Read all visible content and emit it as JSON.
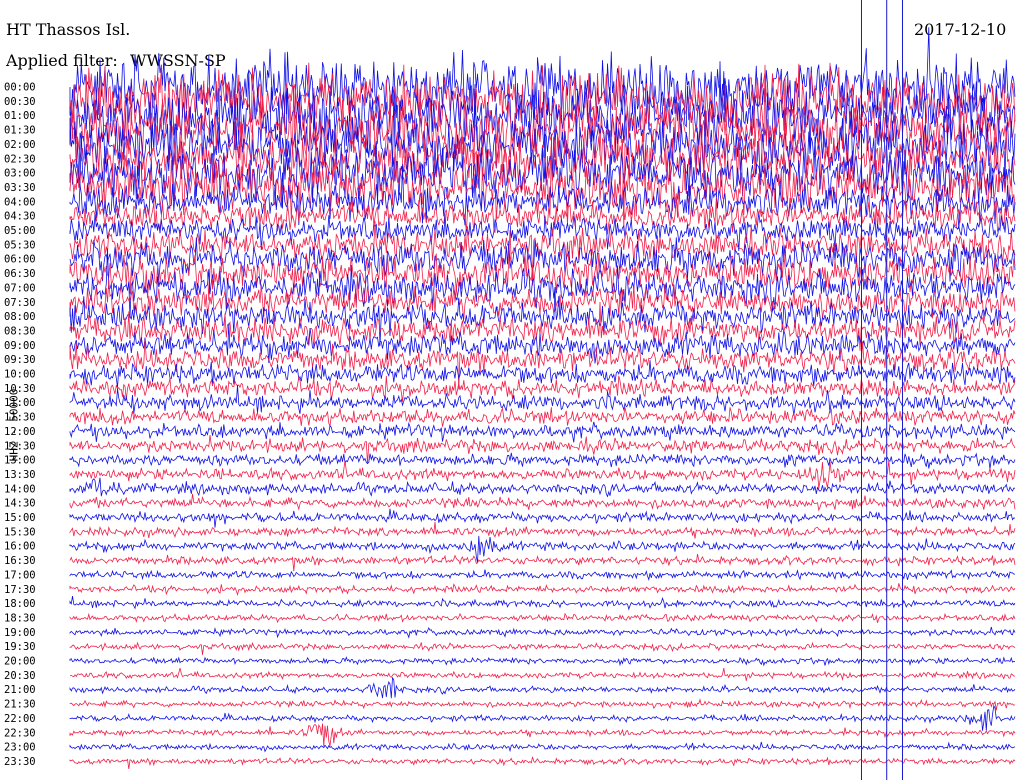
{
  "header": {
    "station": "HT Thassos Isl.",
    "date": "2017-12-10",
    "filter_label": "Applied filter:",
    "filter_value": "WWSSN-SP"
  },
  "colors": {
    "trace_a": "#1010e6",
    "trace_b": "#f0204a",
    "vline": "#1a1ad0"
  },
  "chart_data": {
    "type": "line",
    "title": "HT Thassos Isl.",
    "ylabel": "HHZ - 50000",
    "tick_labels": [
      "00:00",
      "00:30",
      "01:00",
      "01:30",
      "02:00",
      "02:30",
      "03:00",
      "03:30",
      "04:00",
      "04:30",
      "05:00",
      "05:30",
      "06:00",
      "06:30",
      "07:00",
      "07:30",
      "08:00",
      "08:30",
      "09:00",
      "09:30",
      "10:00",
      "10:30",
      "11:00",
      "11:30",
      "12:00",
      "12:30",
      "13:00",
      "13:30",
      "14:00",
      "14:30",
      "15:00",
      "15:30",
      "16:00",
      "16:30",
      "17:00",
      "17:30",
      "18:00",
      "18:30",
      "19:00",
      "19:30",
      "20:00",
      "20:30",
      "21:00",
      "21:30",
      "22:00",
      "22:30",
      "23:00",
      "23:30"
    ],
    "series": [
      {
        "values": [
          1.0,
          1.0,
          0.95,
          0.95,
          0.9,
          0.9,
          0.85,
          0.8,
          0.55,
          0.45,
          0.4,
          0.45,
          0.55,
          0.55,
          0.5,
          0.45,
          0.42,
          0.4,
          0.38,
          0.35,
          0.3,
          0.26,
          0.24,
          0.22,
          0.2,
          0.18,
          0.16,
          0.15,
          0.14,
          0.13,
          0.12,
          0.11,
          0.11,
          0.1,
          0.09,
          0.08,
          0.08,
          0.07,
          0.07,
          0.06,
          0.06,
          0.06,
          0.06,
          0.06,
          0.06,
          0.06,
          0.06,
          0.06
        ]
      }
    ],
    "events": [
      {
        "time": "13:30",
        "minute": 24
      },
      {
        "time": "14:00",
        "minute": 1
      },
      {
        "time": "16:00",
        "minute": 13
      },
      {
        "time": "21:00",
        "minute": 10
      },
      {
        "time": "22:00",
        "minute": 29
      },
      {
        "time": "22:30",
        "minute": 8
      }
    ],
    "marker_lines_minute": [
      25.1,
      25.9,
      26.4
    ]
  }
}
